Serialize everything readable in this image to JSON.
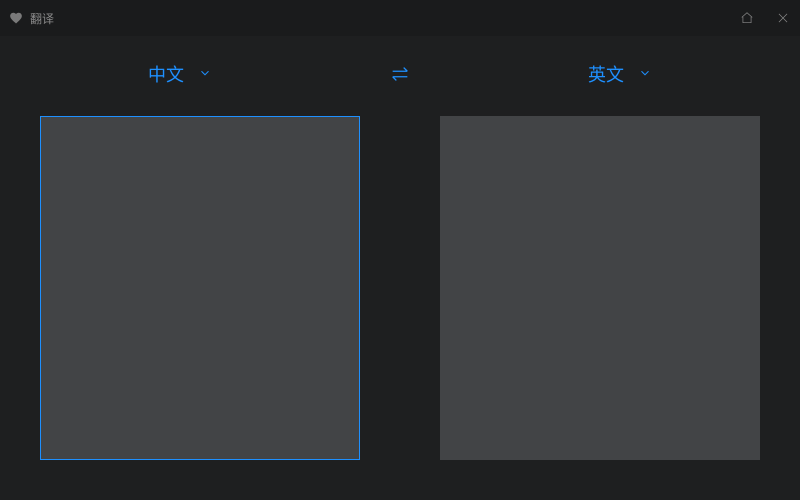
{
  "titlebar": {
    "app_title": "翻译"
  },
  "languages": {
    "source_label": "中文",
    "target_label": "英文"
  }
}
